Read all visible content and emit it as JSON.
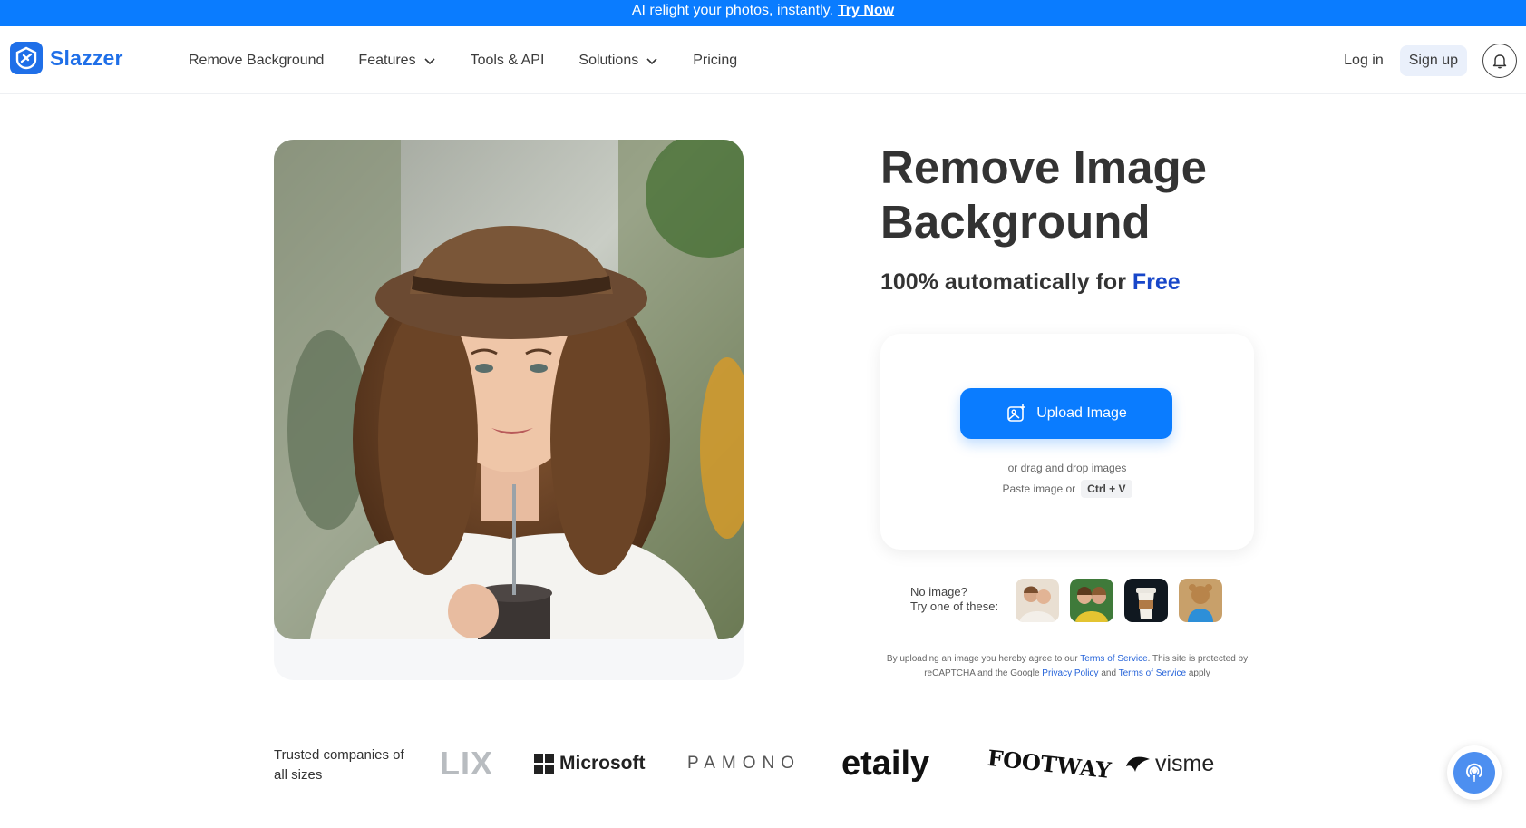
{
  "banner": {
    "text": "AI relight your photos, instantly.",
    "cta": "Try Now"
  },
  "brand": {
    "name": "Slazzer",
    "color": "#1f6fe8"
  },
  "nav": {
    "items": [
      {
        "label": "Remove Background",
        "has_dropdown": false
      },
      {
        "label": "Features",
        "has_dropdown": true
      },
      {
        "label": "Tools & API",
        "has_dropdown": false
      },
      {
        "label": "Solutions",
        "has_dropdown": true
      },
      {
        "label": "Pricing",
        "has_dropdown": false
      }
    ],
    "login": "Log in",
    "signup": "Sign up"
  },
  "hero": {
    "title": "Remove Image Background",
    "subtitle_prefix": "100% automatically for ",
    "subtitle_highlight": "Free"
  },
  "upload": {
    "button_label": "Upload Image",
    "drag_text": "or drag and drop images",
    "paste_text": "Paste image or",
    "shortcut": "Ctrl + V"
  },
  "samples": {
    "prompt_line1": "No image?",
    "prompt_line2": "Try one of these:"
  },
  "terms": {
    "part1": "By uploading an image you hereby agree to our ",
    "link1": "Terms of Service",
    "part2": ". This site is protected by reCAPTCHA and the Google ",
    "link2": "Privacy Policy",
    "part3": " and ",
    "link3": "Terms of Service",
    "part4": " apply"
  },
  "trusted": {
    "label": "Trusted companies of all sizes",
    "logos": [
      "LIX",
      "Microsoft",
      "PAMONO",
      "etaily",
      "FOOTWAY",
      "visme"
    ]
  },
  "colors": {
    "accent": "#0a7cff",
    "highlight": "#1746c9"
  }
}
